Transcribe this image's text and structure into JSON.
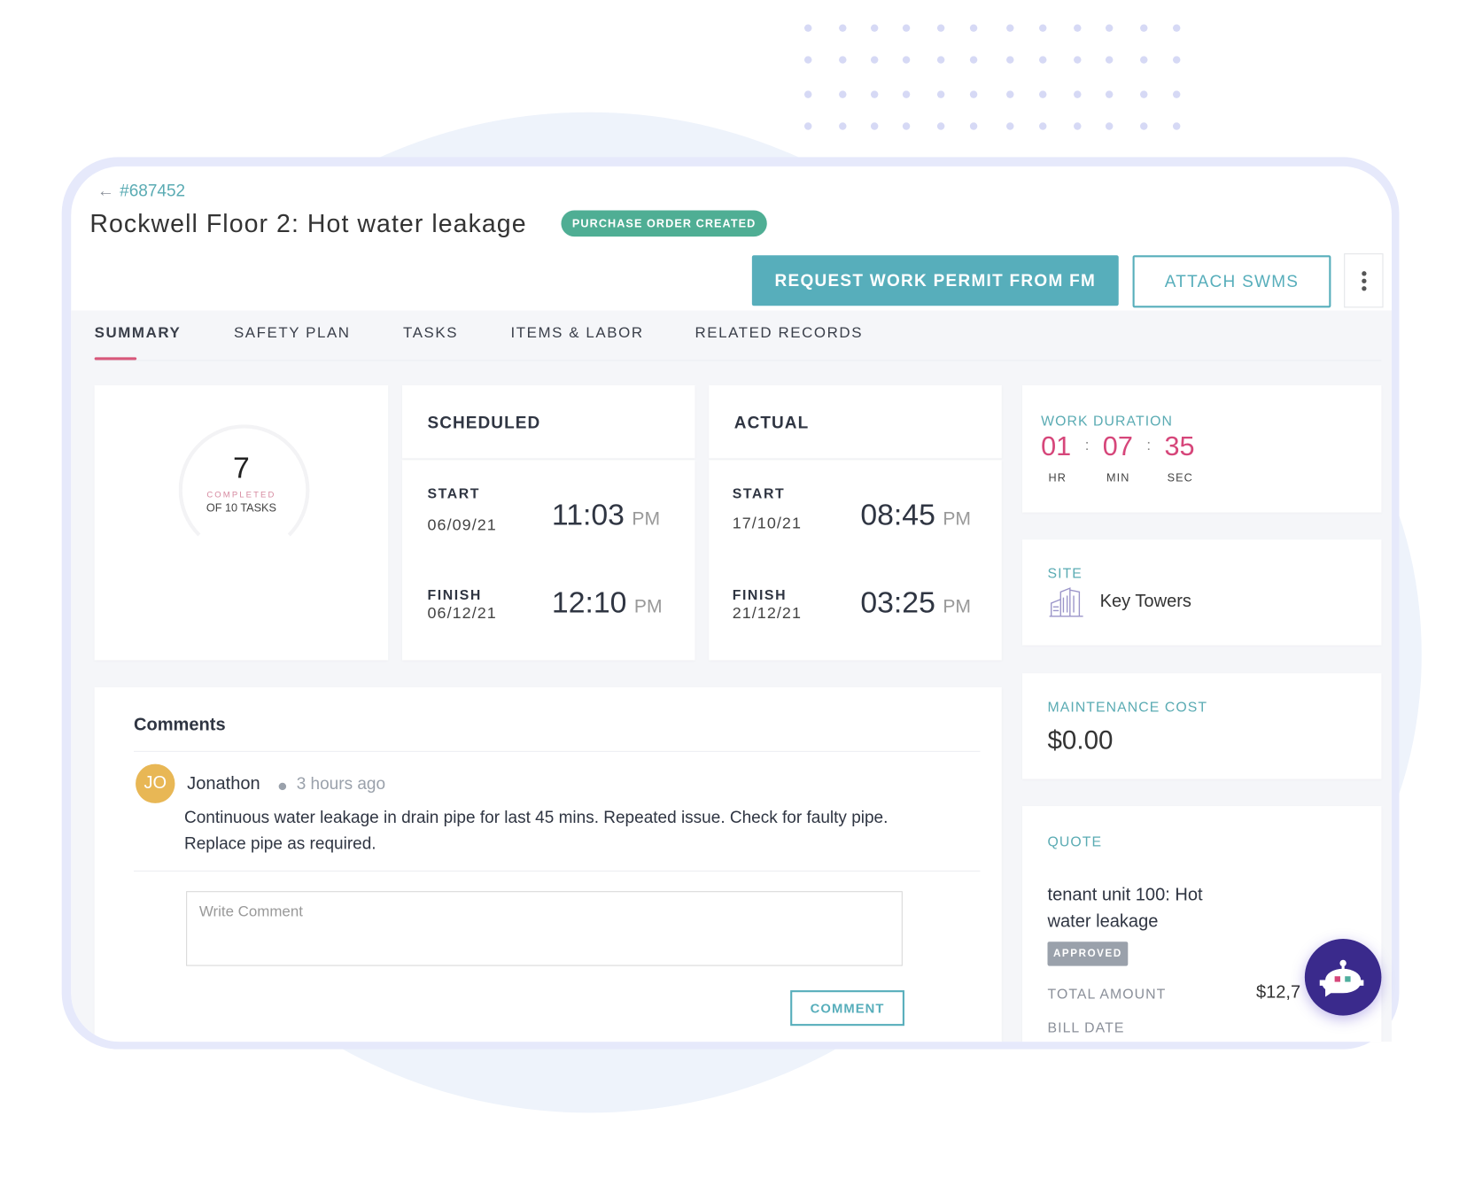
{
  "header": {
    "back_link": "#687452",
    "title": "Rockwell Floor 2: Hot water leakage",
    "status_badge": "PURCHASE ORDER CREATED",
    "request_button": "REQUEST WORK PERMIT FROM FM",
    "attach_button": "ATTACH SWMS"
  },
  "tabs": [
    {
      "label": "SUMMARY",
      "active": true
    },
    {
      "label": "SAFETY PLAN"
    },
    {
      "label": "TASKS"
    },
    {
      "label": "ITEMS & LABOR"
    },
    {
      "label": "RELATED RECORDS"
    }
  ],
  "progress": {
    "completed": "7",
    "completed_label": "COMPLETED",
    "total_label": "OF 10 TASKS",
    "fraction": 0.7
  },
  "scheduled": {
    "heading": "SCHEDULED",
    "start_label": "START",
    "start_date": "06/09/21",
    "start_time": "11:03",
    "start_ampm": "PM",
    "finish_label": "FINISH",
    "finish_date": "06/12/21",
    "finish_time": "12:10",
    "finish_ampm": "PM"
  },
  "actual": {
    "heading": "ACTUAL",
    "start_label": "START",
    "start_date": "17/10/21",
    "start_time": "08:45",
    "start_ampm": "PM",
    "finish_label": "FINISH",
    "finish_date": "21/12/21",
    "finish_time": "03:25",
    "finish_ampm": "PM"
  },
  "work_duration": {
    "heading": "WORK DURATION",
    "hr": "01",
    "min": "07",
    "sec": "35",
    "hr_label": "HR",
    "min_label": "MIN",
    "sec_label": "SEC",
    "sep": ":"
  },
  "site": {
    "heading": "SITE",
    "name": "Key Towers",
    "icon": "building-icon"
  },
  "maintenance": {
    "heading": "MAINTENANCE COST",
    "value": "$0.00"
  },
  "quote": {
    "heading": "QUOTE",
    "title": "tenant unit 100: Hot water leakage",
    "badge": "APPROVED",
    "total_label": "TOTAL AMOUNT",
    "total_value": "$12,7",
    "bill_label": "BILL DATE"
  },
  "comments": {
    "heading": "Comments",
    "items": [
      {
        "initials": "JO",
        "author": "Jonathon",
        "time": "3 hours ago",
        "text": "Continuous water leakage in drain pipe for last 45 mins. Repeated issue. Check for faulty pipe. Replace pipe as required."
      }
    ],
    "placeholder": "Write Comment",
    "submit": "COMMENT"
  },
  "colors": {
    "accent": "#57aebb",
    "pink": "#d6467a",
    "badge_green": "#4fae94",
    "bot": "#3a2a8c",
    "avatar": "#e8b755"
  }
}
